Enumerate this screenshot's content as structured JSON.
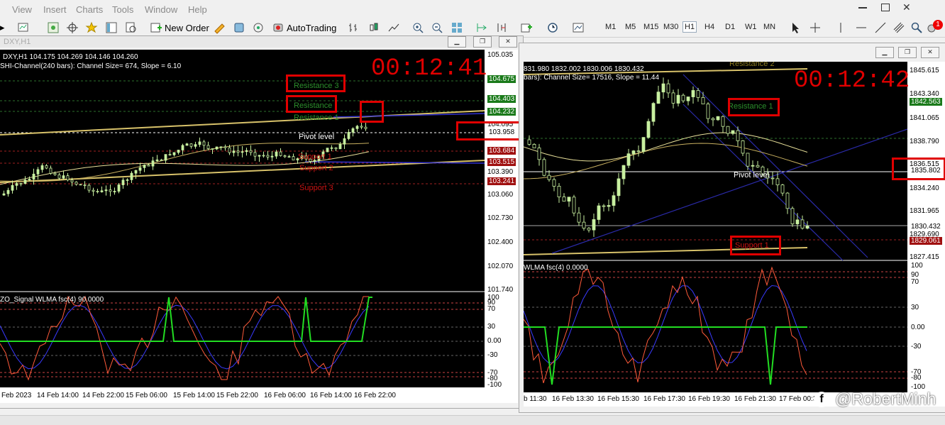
{
  "menu": [
    "View",
    "Insert",
    "Charts",
    "Tools",
    "Window",
    "Help"
  ],
  "toolbar": {
    "new_order": "New Order",
    "autotrading": "AutoTrading",
    "timeframes": [
      "M1",
      "M5",
      "M15",
      "M30",
      "H1",
      "H4",
      "D1",
      "W1",
      "MN"
    ],
    "active_timeframe": "H1",
    "notification_count": "1"
  },
  "left_chart": {
    "window_title": "DXY,H1",
    "symbol_line": "DXY,H1  104.175 104.269 104.146 104.260",
    "indicator_line": "SHI-Channel(240 bars): Channel Size= 674, Slope = 6.10",
    "timer": "00:12:41",
    "levels": {
      "resistance3": "Resistance 3",
      "resistance2": "Resistance",
      "resistance1": "Resistance 1",
      "pivot": "Pivot level",
      "support1": "Support 1",
      "support2": "Support 2",
      "support3": "Support 3"
    },
    "price_axis": [
      "105.035",
      "104.675",
      "104.403",
      "104.232",
      "104.095",
      "103.958",
      "103.684",
      "103.515",
      "103.390",
      "103.241",
      "103.060",
      "102.730",
      "102.400",
      "102.070",
      "101.740"
    ],
    "oscillator_label": "ZO_Signal  WLMA fsc(4) 90.0000",
    "osc_axis": [
      "100",
      "90",
      "70",
      "30",
      "0.00",
      "-30",
      "-70",
      "-80",
      "-100"
    ],
    "time_axis": [
      "Feb 2023",
      "14 Feb 14:00",
      "14 Feb 22:00",
      "15 Feb 06:00",
      "15 Feb 14:00",
      "15 Feb 22:00",
      "16 Feb 06:00",
      "16 Feb 14:00",
      "16 Feb 22:00"
    ]
  },
  "right_chart": {
    "symbol_line": "831.980 1832.002 1830.006 1830.432",
    "indicator_line": "bars): Channel Size= 17516, Slope = 11.44",
    "timer": "00:12:42",
    "levels": {
      "resistance2": "Resistance 2",
      "resistance1": "Resistance 1",
      "pivot": "Pivot level",
      "support1": "Support 1"
    },
    "price_axis": [
      "1845.615",
      "1843.340",
      "1842.563",
      "1841.065",
      "1838.790",
      "1836.515",
      "1835.802",
      "1834.240",
      "1831.965",
      "1830.432",
      "1829.690",
      "1829.061",
      "1827.415"
    ],
    "oscillator_label": "WLMA fsc(4) 0.0000",
    "osc_axis": [
      "100",
      "90",
      "70",
      "30",
      "0.00",
      "-30",
      "-70",
      "-80",
      "-100"
    ],
    "time_axis": [
      "b 11:30",
      "16 Feb 13:30",
      "16 Feb 15:30",
      "16 Feb 17:30",
      "16 Feb 19:30",
      "16 Feb 21:30",
      "17 Feb 00:3"
    ]
  },
  "watermark": "@RobertMinh",
  "colors": {
    "chart_bg": "#000000",
    "candle": "#c8f0a0",
    "osc_green": "#22dd22",
    "osc_red": "#ff5a3a",
    "osc_blue": "#3a3aff",
    "timer": "#e00000"
  }
}
